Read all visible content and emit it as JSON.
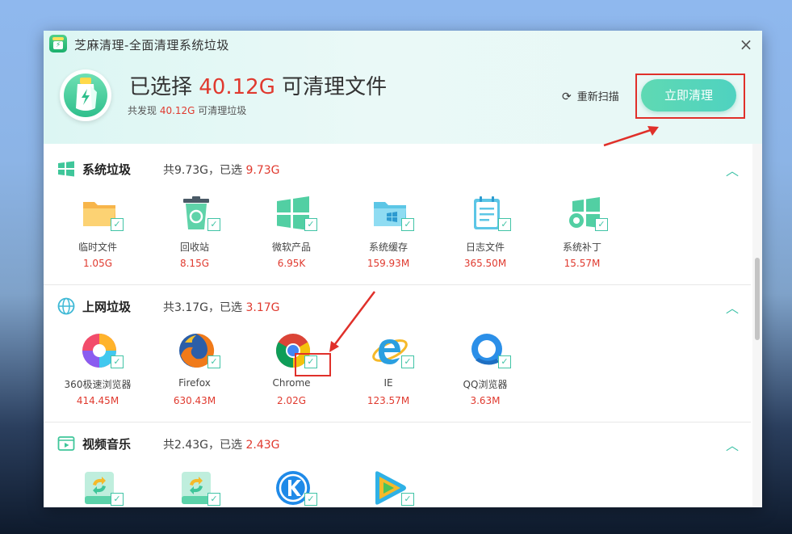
{
  "window": {
    "title": "芝麻清理-全面清理系统垃圾",
    "close_label": "×"
  },
  "header": {
    "headline_prefix": "已选择 ",
    "headline_amount": "40.12G",
    "headline_suffix": " 可清理文件",
    "sub_prefix": "共发现 ",
    "sub_amount": "40.12G",
    "sub_suffix": " 可清理垃圾",
    "rescan_label": "重新扫描",
    "clean_label": "立即清理"
  },
  "sections": [
    {
      "title": "系统垃圾",
      "stat_prefix": "共9.73G，已选 ",
      "stat_selected": "9.73G",
      "items": [
        {
          "name": "临时文件",
          "size": "1.05G",
          "icon": "folder-icon"
        },
        {
          "name": "回收站",
          "size": "8.15G",
          "icon": "recycle-bin-icon"
        },
        {
          "name": "微软产品",
          "size": "6.95K",
          "icon": "windows-icon"
        },
        {
          "name": "系统缓存",
          "size": "159.93M",
          "icon": "windows-folder-icon"
        },
        {
          "name": "日志文件",
          "size": "365.50M",
          "icon": "log-file-icon"
        },
        {
          "name": "系统补丁",
          "size": "15.57M",
          "icon": "windows-patch-icon"
        }
      ]
    },
    {
      "title": "上网垃圾",
      "stat_prefix": "共3.17G，已选 ",
      "stat_selected": "3.17G",
      "items": [
        {
          "name": "360极速浏览器",
          "size": "414.45M",
          "icon": "360-browser-icon"
        },
        {
          "name": "Firefox",
          "size": "630.43M",
          "icon": "firefox-icon"
        },
        {
          "name": "Chrome",
          "size": "2.02G",
          "icon": "chrome-icon"
        },
        {
          "name": "IE",
          "size": "123.57M",
          "icon": "ie-icon"
        },
        {
          "name": "QQ浏览器",
          "size": "3.63M",
          "icon": "qq-browser-icon"
        }
      ]
    },
    {
      "title": "视频音乐",
      "stat_prefix": "共2.43G，已选 ",
      "stat_selected": "2.43G",
      "items": [
        {
          "name": "",
          "size": "",
          "icon": "video-cache-icon"
        },
        {
          "name": "",
          "size": "",
          "icon": "music-cache-icon"
        },
        {
          "name": "",
          "size": "",
          "icon": "kugou-icon"
        },
        {
          "name": "",
          "size": "",
          "icon": "tencent-video-icon"
        }
      ]
    }
  ],
  "colors": {
    "accent": "#41c4a6",
    "highlight": "#e03a2f",
    "annotation": "#e0302a"
  },
  "check_glyph": "✓"
}
